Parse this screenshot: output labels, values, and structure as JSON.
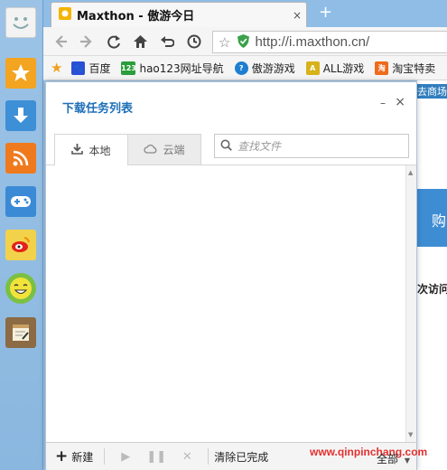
{
  "sidebar": {
    "items": [
      {
        "name": "smiley-logo-icon"
      },
      {
        "name": "favorites-star-icon"
      },
      {
        "name": "download-icon"
      },
      {
        "name": "rss-icon"
      },
      {
        "name": "game-controller-icon"
      },
      {
        "name": "weibo-icon"
      },
      {
        "name": "emoji-icon"
      },
      {
        "name": "notepad-icon"
      }
    ]
  },
  "tabstrip": {
    "tab_title": "Maxthon - 傲游今日",
    "tab_close": "×",
    "new_tab": "+"
  },
  "toolbar": {
    "address_url": "http://i.maxthon.cn/",
    "address_star": "☆"
  },
  "bookmarks": {
    "items": [
      {
        "label": "百度"
      },
      {
        "label": "hao123网址导航"
      },
      {
        "label": "傲游游戏"
      },
      {
        "label": "ALL游戏"
      },
      {
        "label": "淘宝特卖"
      }
    ]
  },
  "background_page": {
    "strip_text": "去商场",
    "blue_text": "购",
    "bold_text": "次访问"
  },
  "download_panel": {
    "title": "下载任务列表",
    "minimize": "–",
    "close": "×",
    "tab_local": "本地",
    "tab_cloud": "云端",
    "search_placeholder": "查找文件",
    "new_label": "新建",
    "play": "▶",
    "pause": "❚❚",
    "stop": "✕",
    "clear_label": "清除已完成",
    "watermark": "www.qinpinchang.com",
    "all_label": "全部"
  }
}
